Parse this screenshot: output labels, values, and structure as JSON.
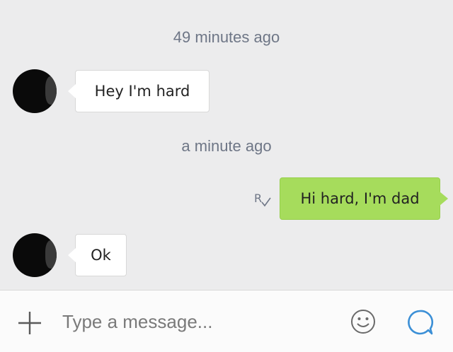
{
  "messages": [
    {
      "type": "timestamp",
      "text": "49 minutes ago"
    },
    {
      "type": "incoming",
      "text": "Hey I'm hard"
    },
    {
      "type": "timestamp",
      "text": "a minute ago"
    },
    {
      "type": "outgoing",
      "text": "Hi hard, I'm dad",
      "read_receipt_label": "R"
    },
    {
      "type": "incoming",
      "text": "Ok"
    }
  ],
  "composer": {
    "placeholder": "Type a message...",
    "icons": [
      "plus-icon",
      "emoji-icon",
      "send-icon"
    ]
  },
  "colors": {
    "background": "#ececed",
    "incoming_bubble": "#ffffff",
    "outgoing_bubble": "#a6dc5c",
    "timestamp_text": "#6e7686",
    "accent": "#3b8fd6"
  }
}
